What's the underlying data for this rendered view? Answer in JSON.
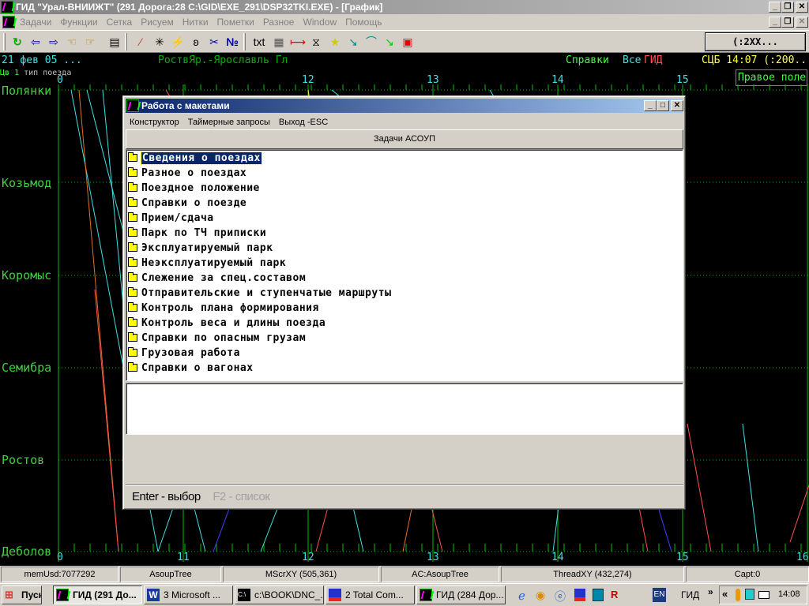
{
  "app": {
    "title": "ГИД \"Урал-ВНИИЖТ\" (291 Дорога:28 C:\\GID\\EXE_291\\DSP32TKI.EXE) - [График]",
    "menu": [
      "Задачи",
      "Функции",
      "Сетка",
      "Рисуем",
      "Нитки",
      "Пометки",
      "Разное",
      "Window",
      "Помощь"
    ],
    "toolbar": {
      "icons": [
        "refresh-icon",
        "page-back-icon",
        "page-forward-icon",
        "hand-left-icon",
        "hand-right-icon",
        "report-icon",
        "wand-icon",
        "sparkle-icon",
        "lightning-icon",
        "figure-icon",
        "scissors-icon",
        "number-icon",
        "txt-icon",
        "layout-icon",
        "red-arrow-icon",
        "line-tool-icon",
        "star-icon",
        "curve-down-icon",
        "curve-up-icon",
        "slope-icon",
        "rectangle-icon"
      ],
      "txt_label": "txt",
      "number_label": "№",
      "right_button": "(:2XX..."
    }
  },
  "graph": {
    "date": "21 фев 05 ...",
    "section": "РоствЯр.-Ярославль Гл",
    "spravki": "Справки",
    "vse": "Все",
    "gid": "ГИД",
    "scb": "СЦБ 14:07 (:200...",
    "color_label": "Цв",
    "color_value": "1",
    "train_type": "тип поезда",
    "right_field": "Правое поле",
    "stations": [
      "Полянки",
      "Козьмод",
      "Коромыс",
      "Семибра",
      "Ростов",
      "Деболов"
    ],
    "hours": [
      "0",
      "11",
      "12",
      "13",
      "14",
      "15",
      "16"
    ],
    "colors": {
      "grid": "#00c000",
      "cyan": "#40e0e0",
      "red": "#ff5050",
      "yellow": "#ffff40",
      "orange": "#e07020",
      "blue": "#4040ff"
    }
  },
  "dialog": {
    "title": "Работа с макетами",
    "menu": [
      "Конструктор",
      "Таймерные запросы",
      "Выход -ESC"
    ],
    "group_button": "Задачи АСОУП",
    "items": [
      "Сведения о поездах",
      "Разное о поездах",
      "Поездное положение",
      "Справки о поезде",
      "Прием/сдача",
      "Парк по ТЧ приписки",
      "Эксплуатируемый парк",
      "Неэксплуатируемый парк",
      "Слежение за спец.составом",
      "Отправительские и ступенчатые маршруты",
      "Контроль плана формирования",
      "Контроль веса и длины поезда",
      "Справки по опасным грузам",
      "Грузовая работа",
      "Справки о вагонах"
    ],
    "selected_index": 0,
    "footer_enter": "Enter - выбор",
    "footer_f2": "F2 - список"
  },
  "status": [
    "memUsd:7077292",
    "AsoupTree",
    "MScrXY (505,361)",
    "AC:AsoupTree",
    "ThreadXY (432,274)",
    "Capt:0"
  ],
  "taskbar": {
    "start": "Пуск",
    "tasks": [
      "ГИД (291 До...",
      "3 Microsoft ...",
      "c:\\BOOK\\DNC_...",
      "2 Total Com...",
      "ГИД (284 Дор..."
    ],
    "lang": "EN",
    "toolbar_label": "ГИД",
    "clock": "14:08"
  }
}
